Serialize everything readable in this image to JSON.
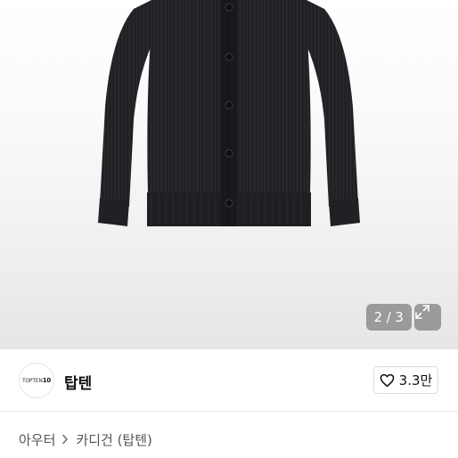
{
  "product": {
    "image_alt": "black button-front knit cardigan",
    "image_counter": {
      "current": "2",
      "separator": "/",
      "total": "3"
    },
    "expand_icon": "expand-arrows-icon"
  },
  "seller": {
    "name": "탑텐",
    "avatar_text_small": "TOPTEN",
    "avatar_text_bold": "10",
    "like_count": "3.3만",
    "like_icon": "heart-outline-icon"
  },
  "breadcrumb": {
    "category": "아우터",
    "separator_icon": "chevron-right-icon",
    "subcategory": "카디건 (탑텐)"
  },
  "colors": {
    "garment": "#1f2023",
    "overlay": "rgba(90,90,90,0.55)",
    "text_secondary": "#555555"
  }
}
